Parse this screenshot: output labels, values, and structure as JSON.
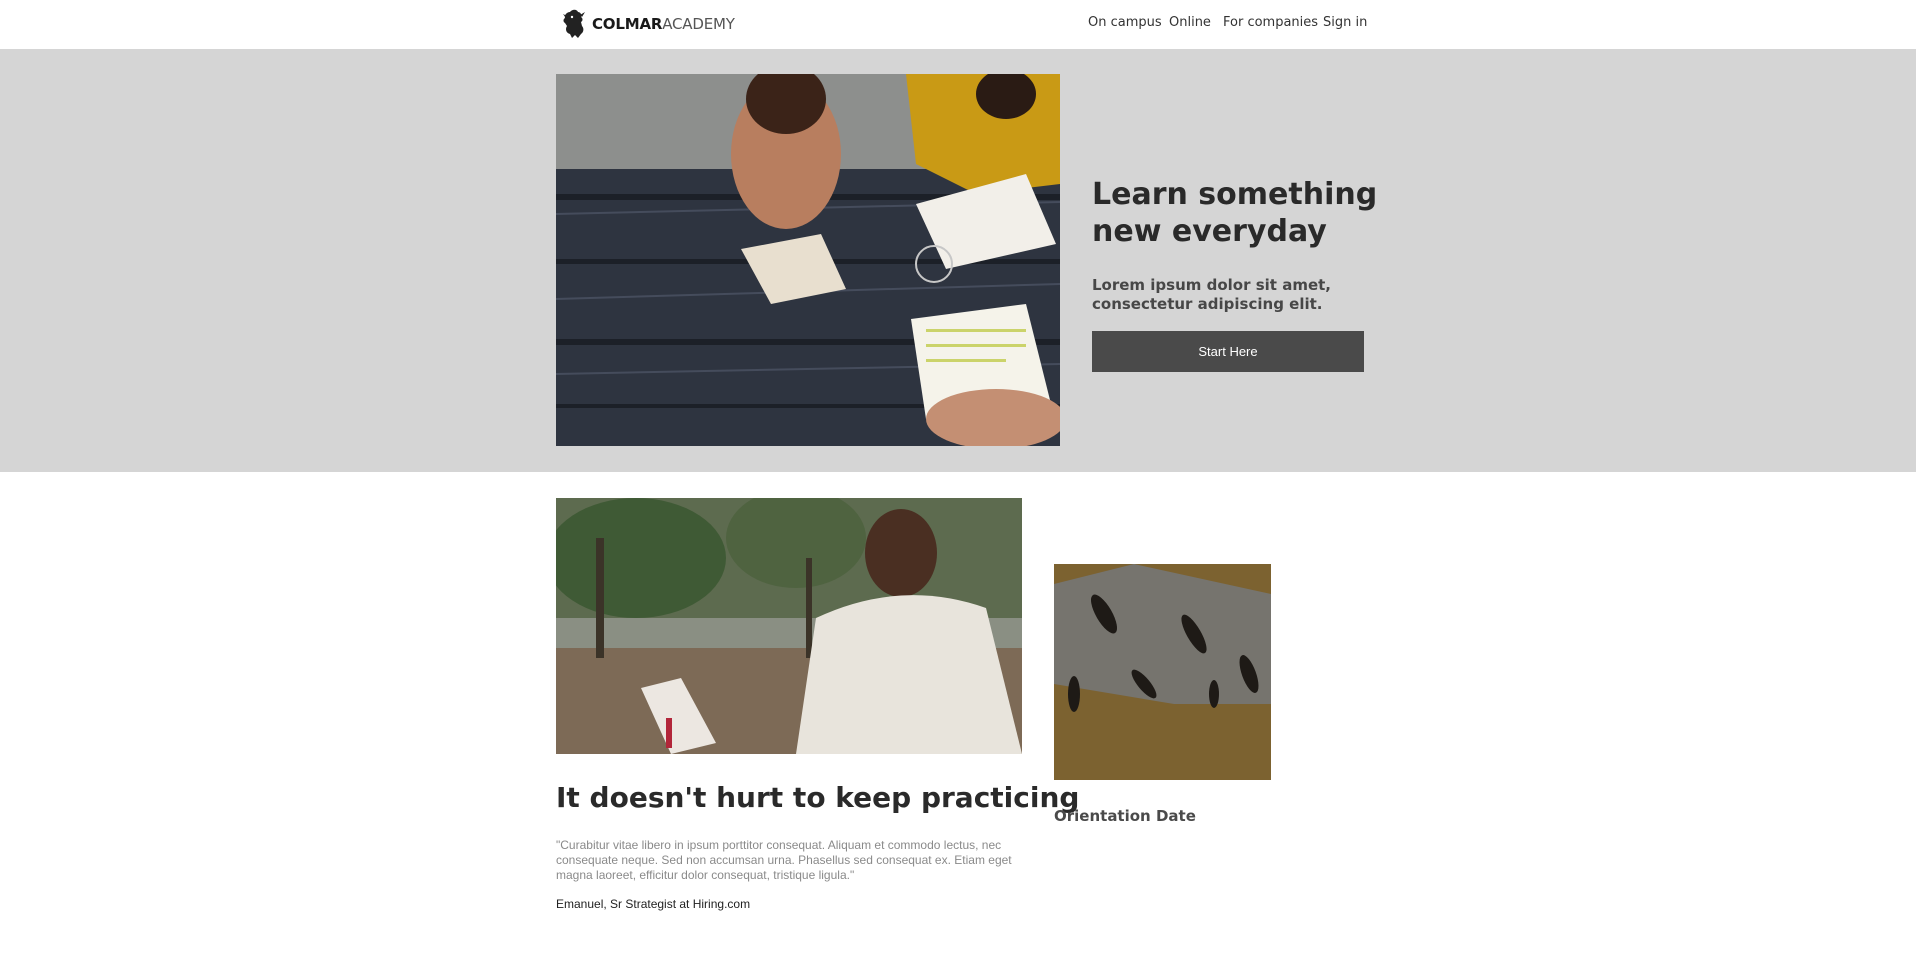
{
  "header": {
    "logo": {
      "bold": "COLMAR",
      "light": "ACADEMY",
      "icon": "griffin-logo-icon"
    },
    "nav": [
      "On campus",
      "Online",
      "For companies",
      "Sign in"
    ]
  },
  "hero": {
    "title": "Learn something new everyday",
    "subtitle": "Lorem ipsum dolor sit amet, consectetur adipiscing elit.",
    "button": "Start Here",
    "photo_icon": "students-reading-photo",
    "bg_color": "#d5d5d5",
    "button_color": "#4a4a4a"
  },
  "feature": {
    "title": "It doesn't hurt to keep practicing",
    "quote": "\"Curabitur vitae libero in ipsum porttitor consequat. Aliquam et commodo lectus, nec consequate neque. Sed non accumsan urna. Phasellus sed consequat ex. Etiam eget magna laoreet, efficitur dolor consequat, tristique ligula.\"",
    "attribution": "Emanuel, Sr Strategist at Hiring.com",
    "photo_icon": "man-reading-photo"
  },
  "orientation": {
    "label": "Orientation Date",
    "photo_icon": "aerial-walkers-photo"
  }
}
